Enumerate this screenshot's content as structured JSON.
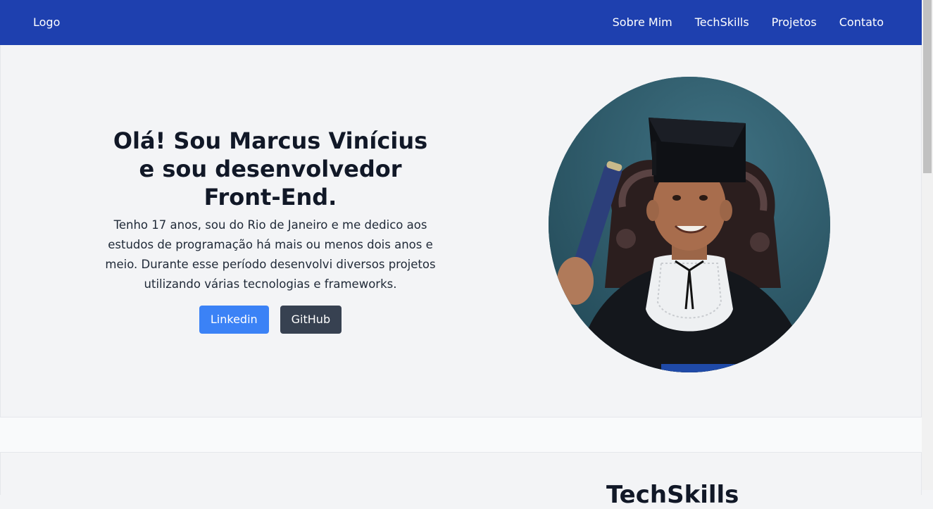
{
  "navbar": {
    "logo": "Logo",
    "links": [
      "Sobre Mim",
      "TechSkills",
      "Projetos",
      "Contato"
    ]
  },
  "hero": {
    "title": "Olá! Sou Marcus Vinícius e sou desenvolvedor Front-End.",
    "description": "Tenho 17 anos, sou do Rio de Janeiro e me dedico aos estudos de programação há mais ou menos dois anos e meio. Durante esse período desenvolvi diversos projetos utilizando várias tecnologias e frameworks.",
    "buttons": {
      "linkedin": "Linkedin",
      "github": "GitHub"
    }
  },
  "skills": {
    "title": "TechSkills"
  },
  "colors": {
    "navbar": "#1e40af",
    "linkedin_button": "#3b82f6",
    "github_button": "#374151",
    "section_background": "#f3f4f6"
  }
}
